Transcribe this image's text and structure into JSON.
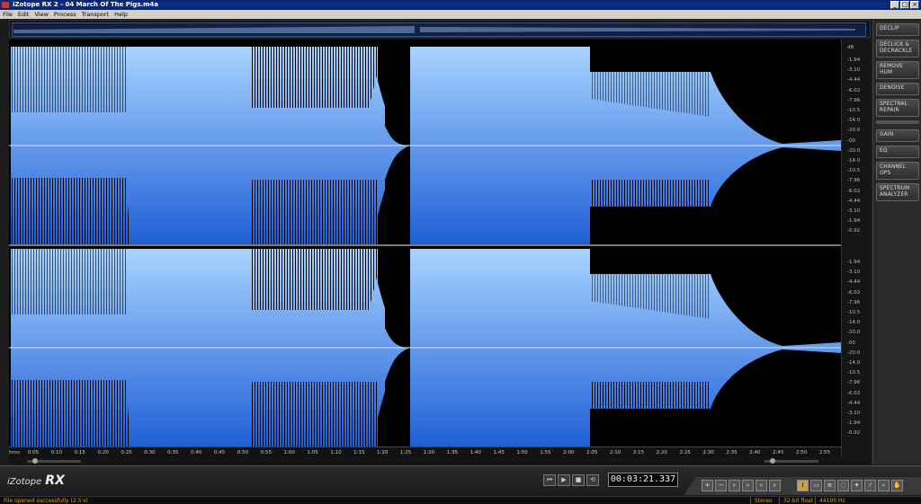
{
  "window": {
    "title": "iZotope RX 2 - 04 March Of The Pigs.m4a"
  },
  "menu": [
    "File",
    "Edit",
    "View",
    "Process",
    "Transport",
    "Help"
  ],
  "db_scale": {
    "unit": "dB",
    "labels": [
      "-1.94",
      "-3.10",
      "-4.44",
      "-6.02",
      "-7.96",
      "-10.5",
      "-14.0",
      "-20.0",
      "-00",
      "-20.0",
      "-14.0",
      "-10.5",
      "-7.96",
      "-6.02",
      "-4.44",
      "-3.10",
      "-1.94",
      "-0.92"
    ]
  },
  "timeline": {
    "unit": "hms",
    "labels": [
      "0:05",
      "0:10",
      "0:15",
      "0:20",
      "0:25",
      "0:30",
      "0:35",
      "0:40",
      "0:45",
      "0:50",
      "0:55",
      "1:00",
      "1:05",
      "1:10",
      "1:15",
      "1:20",
      "1:25",
      "1:30",
      "1:35",
      "1:40",
      "1:45",
      "1:50",
      "1:55",
      "2:00",
      "2:05",
      "2:10",
      "2:15",
      "2:20",
      "2:25",
      "2:30",
      "2:35",
      "2:40",
      "2:45",
      "2:50",
      "2:55"
    ]
  },
  "modules": [
    "DECLIP",
    "DECLICK & DECRACKLE",
    "REMOVE HUM",
    "DENOISE",
    "SPECTRAL REPAIR",
    "GAIN",
    "EQ",
    "CHANNEL OPS",
    "SPECTRUM ANALYZER"
  ],
  "transport": {
    "time": "00:03:21.337"
  },
  "logo": {
    "brand": "iZotope",
    "product": "RX"
  },
  "status": {
    "message": "File opened successfully (2.5 s)",
    "channels": "Stereo",
    "bitdepth": "32-bit float",
    "samplerate": "44100 Hz"
  },
  "colors": {
    "wave_top": "#a8d4ff",
    "wave_bottom": "#1f5fd6",
    "status_text": "#d8a020"
  }
}
